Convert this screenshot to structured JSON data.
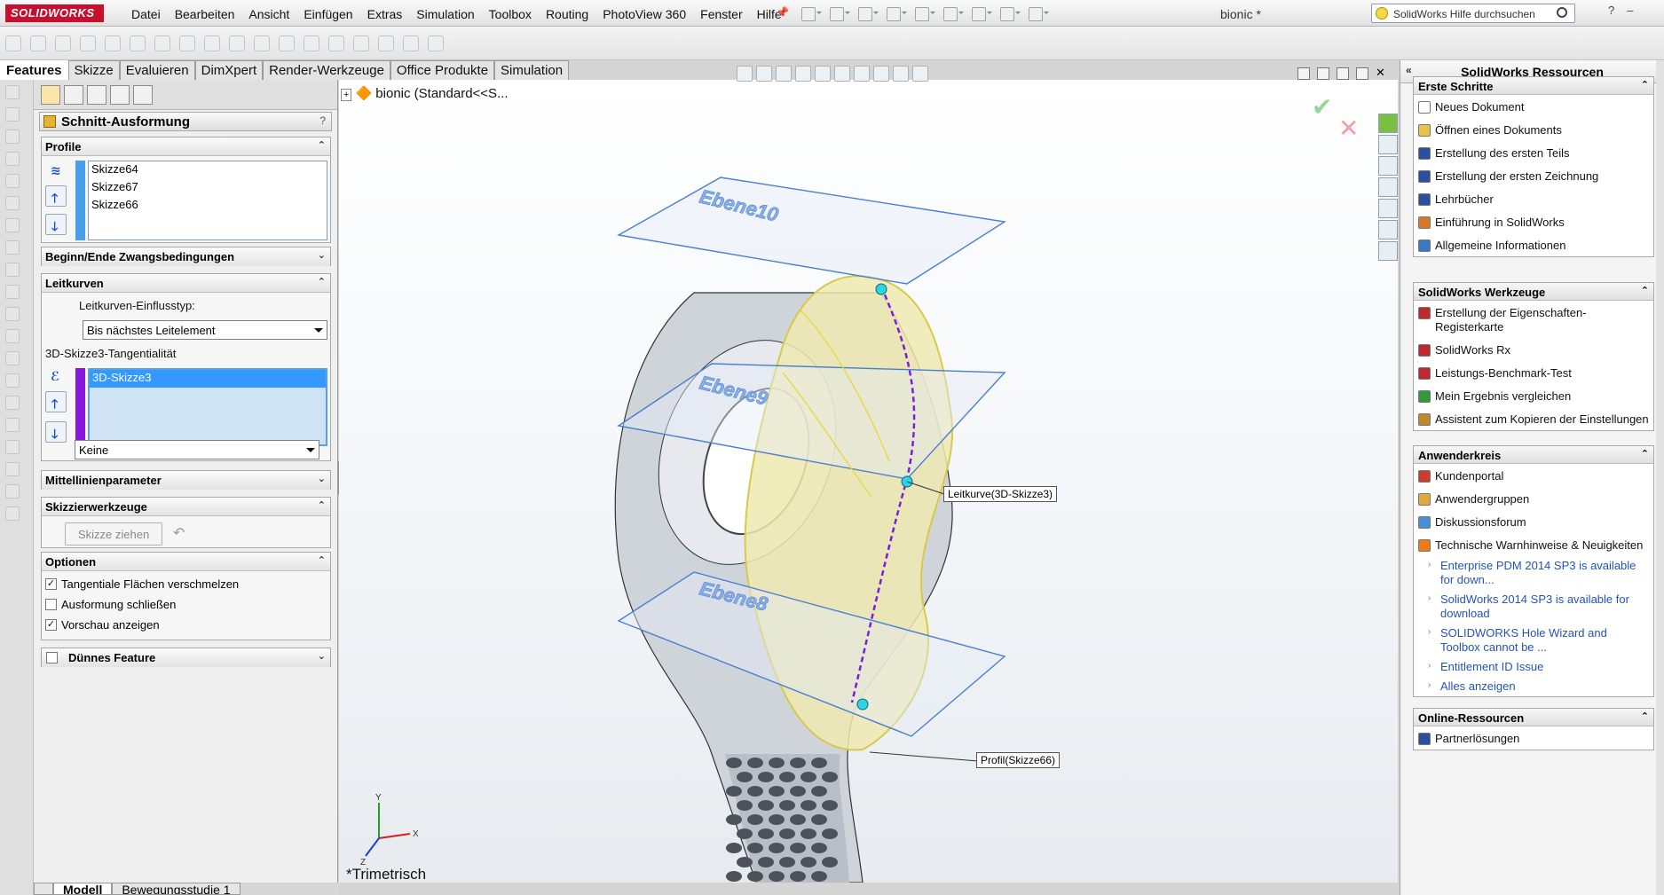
{
  "app": {
    "logo": "SOLIDWORKS",
    "document_title": "bionic *"
  },
  "menu": [
    "Datei",
    "Bearbeiten",
    "Ansicht",
    "Einfügen",
    "Extras",
    "Simulation",
    "Toolbox",
    "Routing",
    "PhotoView 360",
    "Fenster",
    "Hilfe"
  ],
  "help_search": {
    "placeholder": "SolidWorks Hilfe durchsuchen"
  },
  "command_tabs": [
    {
      "label": "Features",
      "active": true
    },
    {
      "label": "Skizze"
    },
    {
      "label": "Evaluieren"
    },
    {
      "label": "DimXpert"
    },
    {
      "label": "Render-Werkzeuge"
    },
    {
      "label": "Office Produkte"
    },
    {
      "label": "Simulation"
    }
  ],
  "property_manager": {
    "title": "Schnitt-Ausformung",
    "help": "?",
    "ok": "✔",
    "cancel": "✖",
    "profile": {
      "header": "Profile",
      "items": [
        "Skizze64",
        "Skizze67",
        "Skizze66"
      ]
    },
    "start_end": {
      "header": "Beginn/Ende Zwangsbedingungen"
    },
    "guides": {
      "header": "Leitkurven",
      "influence_label": "Leitkurven-Einflusstyp:",
      "influence_value": "Bis nächstes Leitelement",
      "tangency_label": "3D-Skizze3-Tangentialität",
      "items": [
        "3D-Skizze3"
      ],
      "tangency_value": "Keine"
    },
    "centerline": {
      "header": "Mittellinienparameter"
    },
    "sketch_tools": {
      "header": "Skizzierwerkzeuge",
      "button": "Skizze ziehen"
    },
    "options": {
      "header": "Optionen",
      "items": [
        {
          "label": "Tangentiale Flächen verschmelzen",
          "checked": true
        },
        {
          "label": "Ausformung schließen",
          "checked": false
        },
        {
          "label": "Vorschau anzeigen",
          "checked": true
        }
      ]
    },
    "thin": {
      "header": "Dünnes Feature"
    }
  },
  "viewport": {
    "tree_label": "bionic  (Standard<<S...",
    "planes": [
      "Ebene10",
      "Ebene9",
      "Ebene8"
    ],
    "callout_guide": "Leitkurve(3D-Skizze3)",
    "callout_profile": "Profil(Skizze66)",
    "view_name": "*Trimetrisch",
    "axes": {
      "x": "X",
      "y": "Y",
      "z": "Z"
    }
  },
  "bottom_tabs": [
    {
      "label": "Modell",
      "active": true
    },
    {
      "label": "Bewegungsstudie 1"
    }
  ],
  "task_pane": {
    "title": "SolidWorks Ressourcen",
    "groups": [
      {
        "header": "Erste Schritte",
        "items": [
          {
            "label": "Neues Dokument",
            "icon": "new-doc-icon",
            "color": "#ffffff"
          },
          {
            "label": "Öffnen eines Dokuments",
            "icon": "open-folder-icon",
            "color": "#e8c24a"
          },
          {
            "label": "Erstellung des ersten Teils",
            "icon": "tutorial-cap-icon",
            "color": "#2a4ea0"
          },
          {
            "label": "Erstellung der ersten Zeichnung",
            "icon": "tutorial-cap-icon",
            "color": "#2a4ea0"
          },
          {
            "label": "Lehrbücher",
            "icon": "tutorial-cap-icon",
            "color": "#2a4ea0"
          },
          {
            "label": "Einführung in SolidWorks",
            "icon": "intro-icon",
            "color": "#d9772a"
          },
          {
            "label": "Allgemeine Informationen",
            "icon": "info-icon",
            "color": "#3a78c8"
          }
        ]
      },
      {
        "header": "SolidWorks Werkzeuge",
        "items": [
          {
            "label": "Erstellung der Eigenschaften-Registerkarte",
            "icon": "tool-icon",
            "color": "#c0282d"
          },
          {
            "label": "SolidWorks Rx",
            "icon": "tool-icon",
            "color": "#c0282d"
          },
          {
            "label": "Leistungs-Benchmark-Test",
            "icon": "tool-icon",
            "color": "#c0282d"
          },
          {
            "label": "Mein Ergebnis vergleichen",
            "icon": "compare-icon",
            "color": "#2f9a3a"
          },
          {
            "label": "Assistent zum Kopieren der Einstellungen",
            "icon": "wizard-icon",
            "color": "#c08a2a"
          }
        ]
      },
      {
        "header": "Anwenderkreis",
        "items": [
          {
            "label": "Kundenportal",
            "icon": "portal-icon",
            "color": "#cc3b2b"
          },
          {
            "label": "Anwendergruppen",
            "icon": "users-icon",
            "color": "#e2a93a"
          },
          {
            "label": "Diskussionsforum",
            "icon": "forum-icon",
            "color": "#4a8ed8"
          },
          {
            "label": "Technische Warnhinweise & Neuigkeiten",
            "icon": "rss-icon",
            "color": "#f07a1a"
          }
        ],
        "links": [
          "Enterprise PDM 2014 SP3 is available for down...",
          "SolidWorks 2014 SP3 is available for download",
          "SOLIDWORKS Hole Wizard and Toolbox cannot be ...",
          "Entitlement ID Issue",
          "Alles anzeigen"
        ]
      },
      {
        "header": "Online-Ressourcen",
        "items": [
          {
            "label": "Partnerlösungen",
            "icon": "partner-icon",
            "color": "#2a4ea0"
          }
        ]
      }
    ]
  }
}
